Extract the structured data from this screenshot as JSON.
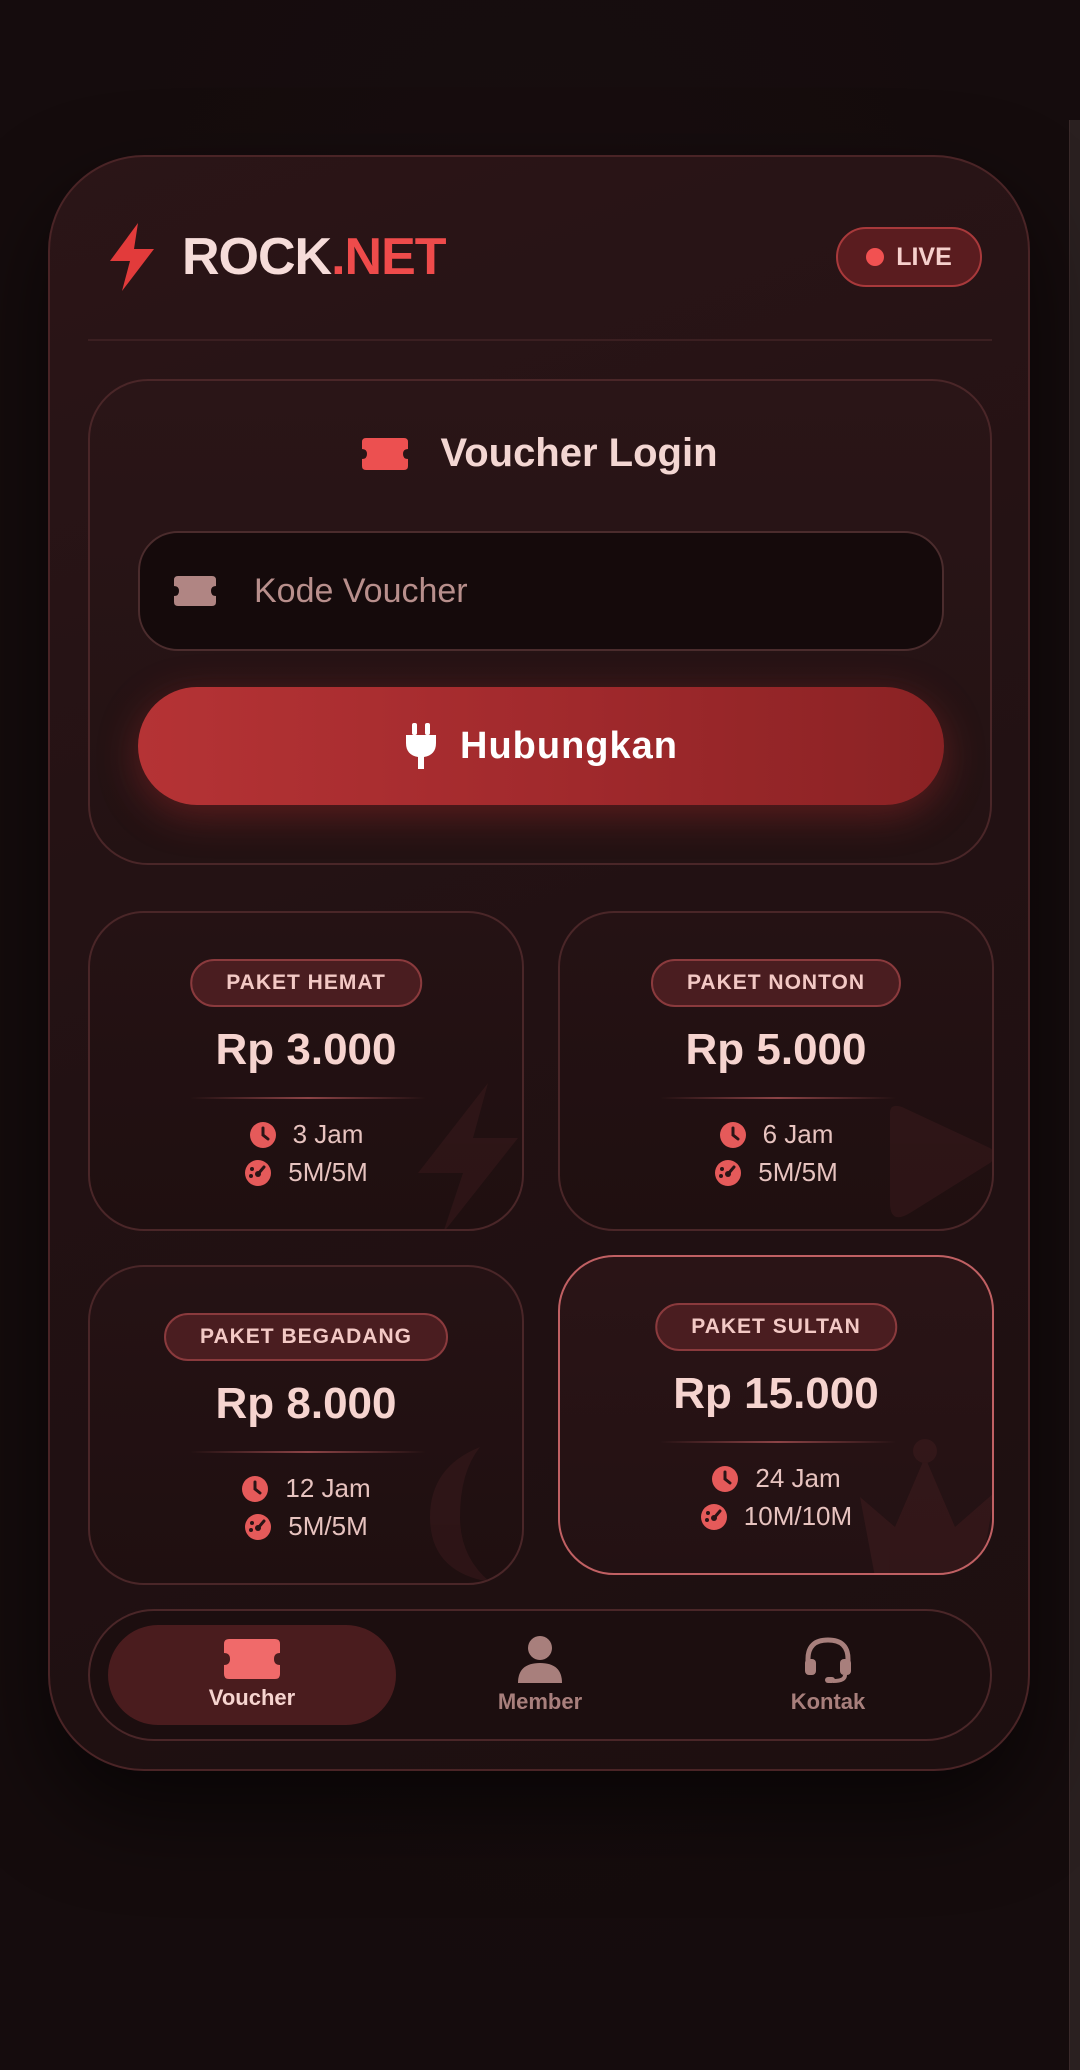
{
  "brand": {
    "name_main": "ROCK",
    "name_accent": ".NET",
    "status_label": "LIVE"
  },
  "login": {
    "title": "Voucher Login",
    "input_placeholder": "Kode Voucher",
    "button_label": "Hubungkan"
  },
  "packages": [
    {
      "name": "PAKET HEMAT",
      "price": "Rp 3.000",
      "duration": "3 Jam",
      "speed": "5M/5M",
      "bg_icon": "bolt-icon"
    },
    {
      "name": "PAKET NONTON",
      "price": "Rp 5.000",
      "duration": "6 Jam",
      "speed": "5M/5M",
      "bg_icon": "play-icon"
    },
    {
      "name": "PAKET BEGADANG",
      "price": "Rp 8.000",
      "duration": "12 Jam",
      "speed": "5M/5M",
      "bg_icon": "moon-icon"
    },
    {
      "name": "PAKET SULTAN",
      "price": "Rp 15.000",
      "duration": "24 Jam",
      "speed": "10M/10M",
      "bg_icon": "crown-icon"
    }
  ],
  "nav": {
    "items": [
      {
        "label": "Voucher",
        "icon": "ticket-icon",
        "active": true
      },
      {
        "label": "Member",
        "icon": "user-icon",
        "active": false
      },
      {
        "label": "Kontak",
        "icon": "headset-icon",
        "active": false
      }
    ]
  },
  "colors": {
    "accent": "#ef4b4b",
    "background": "#150c0d",
    "card": "#221113",
    "text_light": "#f6d4cf"
  }
}
